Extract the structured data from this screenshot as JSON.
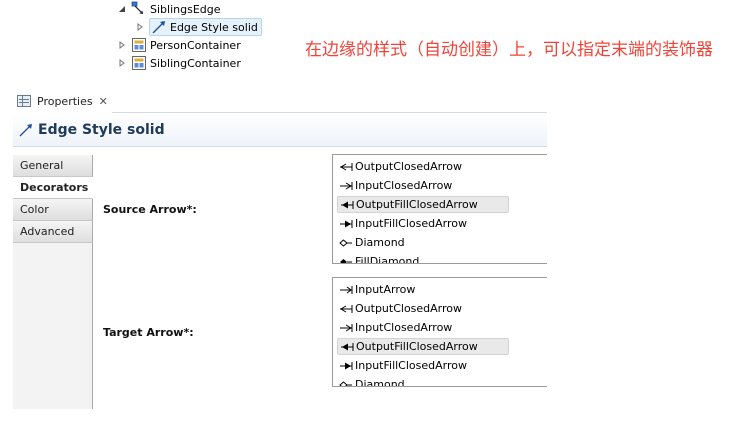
{
  "tree": {
    "items": [
      {
        "label": "SiblingsEdge",
        "twisty": "expanded",
        "icon": "edge-mapping-icon"
      },
      {
        "label": "Edge Style solid",
        "twisty": "collapsed",
        "icon": "edge-style-icon",
        "selected": true
      },
      {
        "label": "PersonContainer",
        "twisty": "collapsed",
        "icon": "container-mapping-icon"
      },
      {
        "label": "SiblingContainer",
        "twisty": "collapsed",
        "icon": "container-mapping-icon"
      }
    ]
  },
  "annotation": {
    "text": "在边缘的样式（自动创建）上，可以指定末端的装饰器",
    "color": "#f0443a"
  },
  "properties_view": {
    "tab_label": "Properties",
    "close_glyph": "✕",
    "title": "Edge Style solid",
    "left_tabs": [
      {
        "label": "General",
        "active": false
      },
      {
        "label": "Decorators",
        "active": true
      },
      {
        "label": "Color",
        "active": false
      },
      {
        "label": "Advanced",
        "active": false
      }
    ],
    "source_arrow": {
      "label": "Source Arrow*:",
      "options": [
        {
          "label": "OutputClosedArrow",
          "icon": "output-closed-arrow-icon"
        },
        {
          "label": "InputClosedArrow",
          "icon": "input-closed-arrow-icon"
        },
        {
          "label": "OutputFillClosedArrow",
          "icon": "output-fill-closed-arrow-icon",
          "selected": true
        },
        {
          "label": "InputFillClosedArrow",
          "icon": "input-fill-closed-arrow-icon"
        },
        {
          "label": "Diamond",
          "icon": "diamond-icon"
        },
        {
          "label": "FillDiamond",
          "icon": "fill-diamond-icon"
        }
      ]
    },
    "target_arrow": {
      "label": "Target Arrow*:",
      "options": [
        {
          "label": "InputArrow",
          "icon": "input-arrow-icon"
        },
        {
          "label": "OutputClosedArrow",
          "icon": "output-closed-arrow-icon"
        },
        {
          "label": "InputClosedArrow",
          "icon": "input-closed-arrow-icon"
        },
        {
          "label": "OutputFillClosedArrow",
          "icon": "output-fill-closed-arrow-icon",
          "selected": true
        },
        {
          "label": "InputFillClosedArrow",
          "icon": "input-fill-closed-arrow-icon"
        },
        {
          "label": "Diamond",
          "icon": "diamond-icon"
        }
      ]
    }
  }
}
